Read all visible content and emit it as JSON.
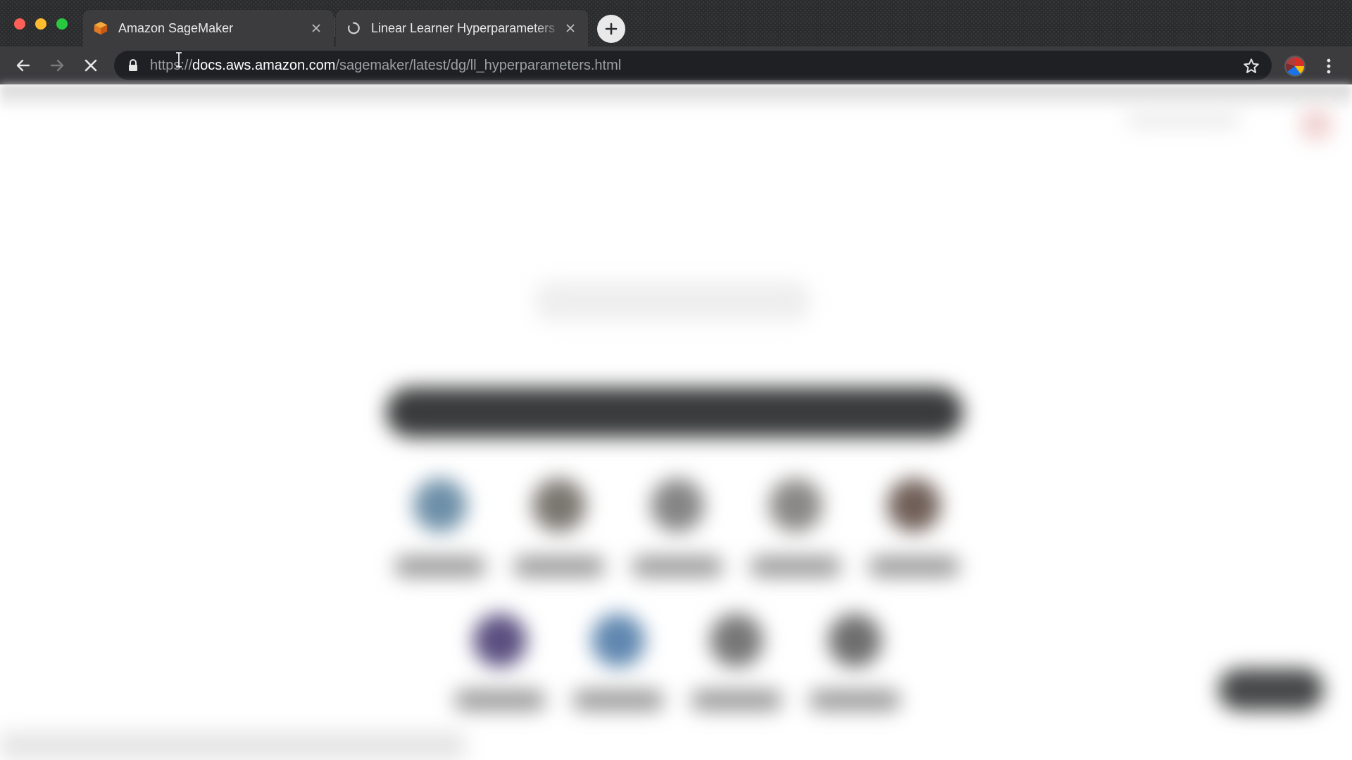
{
  "window": {
    "colors": {
      "tabbar": "#2b2c2e",
      "toolbar": "#3c3c3f",
      "omnibox": "#1f2023"
    }
  },
  "tabs": [
    {
      "title": "Amazon SageMaker",
      "icon": "sagemaker-cube-icon",
      "active": true
    },
    {
      "title": "Linear Learner Hyperparameters",
      "icon": "loading-spinner-icon",
      "active": false
    }
  ],
  "toolbar": {
    "url_scheme": "https",
    "url_sep": "://",
    "url_host": "docs.aws.amazon.com",
    "url_path": "/sagemaker/latest/dg/ll_hyperparameters.html",
    "loading": true
  },
  "page": {
    "blurred": true,
    "icon_row_1_colors": [
      "#6d8fa8",
      "#7b7670",
      "#858585",
      "#8a8886",
      "#705f58"
    ],
    "icon_row_2_colors": [
      "#5a4f80",
      "#5f87b0",
      "#777777",
      "#6e6e6e"
    ]
  }
}
